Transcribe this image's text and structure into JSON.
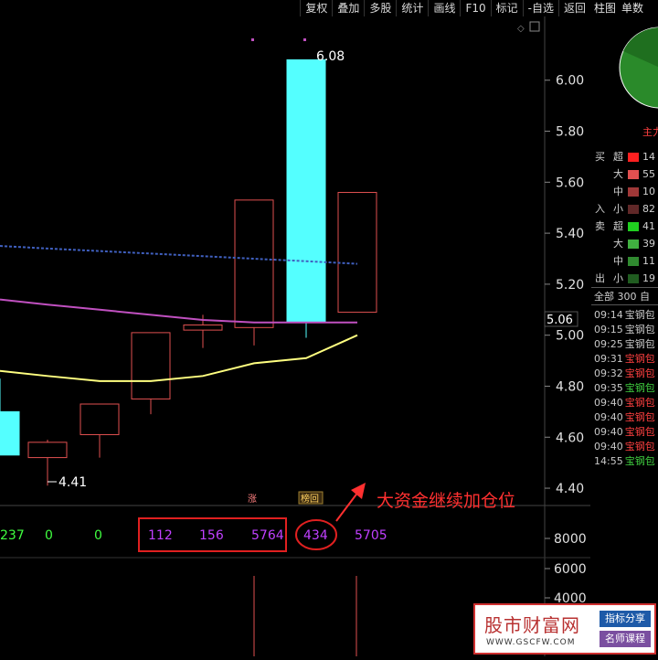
{
  "toolbar": {
    "buttons": [
      "复权",
      "叠加",
      "多股",
      "统计",
      "画线",
      "F10",
      "标记",
      "-自选",
      "返回"
    ]
  },
  "right_tabs": [
    "柱图",
    "单数"
  ],
  "price_axis": {
    "ticks": [
      "6.00",
      "5.80",
      "5.60",
      "5.40",
      "5.20",
      "5.00",
      "4.80",
      "4.60",
      "4.40"
    ],
    "current": "5.06"
  },
  "annotations": {
    "high": "6.08",
    "low": "4.41",
    "badge_limit": "涨",
    "badge_list": "榜回",
    "big_fund_note": "大资金继续加仓位"
  },
  "indicator": {
    "values": [
      "237",
      "0",
      "0",
      "112",
      "156",
      "5764",
      "434",
      "5705"
    ],
    "axis": [
      "8000",
      "6000",
      "4000"
    ]
  },
  "capital_flow": {
    "pie_label": "主力",
    "buy_label": "买",
    "in_label": "入",
    "sell_label": "卖",
    "out_label": "出",
    "rows": [
      {
        "size": "超",
        "value": "14",
        "color": "#ff2020"
      },
      {
        "size": "大",
        "value": "55",
        "color": "#e05050"
      },
      {
        "size": "中",
        "value": "10",
        "color": "#a03838"
      },
      {
        "size": "小",
        "value": "82",
        "color": "#602828"
      },
      {
        "size": "超",
        "value": "41",
        "color": "#20d020"
      },
      {
        "size": "大",
        "value": "39",
        "color": "#40b040"
      },
      {
        "size": "中",
        "value": "11",
        "color": "#308a30"
      },
      {
        "size": "小",
        "value": "19",
        "color": "#205c20"
      }
    ]
  },
  "trades_header": "全部 300  自",
  "trades": [
    {
      "time": "09:14",
      "name": "宝钢包",
      "color": "#c8c8c8"
    },
    {
      "time": "09:15",
      "name": "宝钢包",
      "color": "#c8c8c8"
    },
    {
      "time": "09:25",
      "name": "宝钢包",
      "color": "#c8c8c8"
    },
    {
      "time": "09:31",
      "name": "宝钢包",
      "color": "#ff4040"
    },
    {
      "time": "09:32",
      "name": "宝钢包",
      "color": "#ff4040"
    },
    {
      "time": "09:35",
      "name": "宝钢包",
      "color": "#40d040"
    },
    {
      "time": "09:40",
      "name": "宝钢包",
      "color": "#ff4040"
    },
    {
      "time": "09:40",
      "name": "宝钢包",
      "color": "#ff4040"
    },
    {
      "time": "09:40",
      "name": "宝钢包",
      "color": "#ff4040"
    },
    {
      "time": "09:40",
      "name": "宝钢包",
      "color": "#ff4040"
    },
    {
      "time": "14:55",
      "name": "宝钢包",
      "color": "#40d040"
    }
  ],
  "watermark": {
    "brand": "股市财富网",
    "url": "WWW.GSCFW.COM",
    "tag1": "指标分享",
    "tag2": "名师课程"
  },
  "colors": {
    "up": "#e05050",
    "down": "#54ffff",
    "ma_yellow": "#ffff80",
    "ma_purple": "#c050c0",
    "ma_blue": "#4060c0",
    "indicator_text": "#c040ff",
    "indicator_green": "#40ff40",
    "highlight": "#e02020"
  },
  "chart_data": {
    "type": "candlestick",
    "candles": [
      {
        "open": 4.7,
        "close": 4.53,
        "high": 4.83,
        "low": 4.53,
        "color": "down"
      },
      {
        "open": 4.52,
        "close": 4.58,
        "high": 4.59,
        "low": 4.41,
        "color": "up"
      },
      {
        "open": 4.61,
        "close": 4.73,
        "high": 4.73,
        "low": 4.52,
        "color": "up"
      },
      {
        "open": 4.75,
        "close": 5.01,
        "high": 5.01,
        "low": 4.69,
        "color": "up"
      },
      {
        "open": 5.02,
        "close": 5.04,
        "high": 5.08,
        "low": 4.95,
        "color": "up"
      },
      {
        "open": 5.03,
        "close": 5.53,
        "high": 5.53,
        "low": 4.96,
        "color": "up"
      },
      {
        "open": 6.08,
        "close": 5.05,
        "high": 6.08,
        "low": 4.99,
        "color": "down"
      },
      {
        "open": 5.09,
        "close": 5.56,
        "high": 5.56,
        "low": 5.09,
        "color": "up"
      }
    ],
    "ma_yellow": [
      4.86,
      4.84,
      4.82,
      4.82,
      4.84,
      4.89,
      4.91,
      5.0
    ],
    "ma_purple": [
      5.14,
      5.12,
      5.1,
      5.08,
      5.06,
      5.05,
      5.05,
      5.05
    ],
    "ma_blue": [
      5.35,
      5.34,
      5.33,
      5.32,
      5.31,
      5.3,
      5.29,
      5.28
    ],
    "y_range": [
      4.35,
      6.25
    ]
  }
}
